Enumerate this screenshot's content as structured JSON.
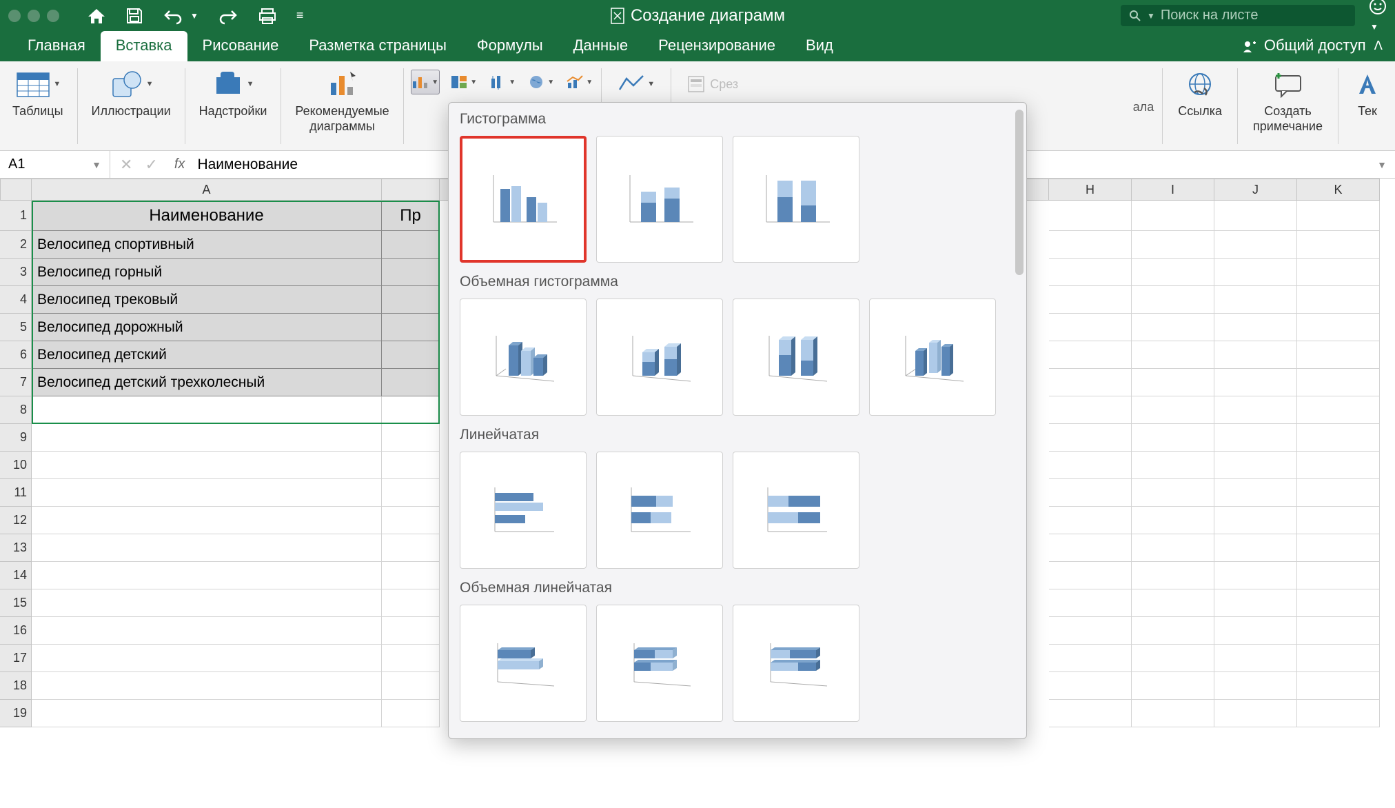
{
  "titlebar": {
    "doc_title": "Создание диаграмм",
    "search_placeholder": "Поиск на листе"
  },
  "tabs": {
    "items": [
      "Главная",
      "Вставка",
      "Рисование",
      "Разметка страницы",
      "Формулы",
      "Данные",
      "Рецензирование",
      "Вид"
    ],
    "active_index": 1,
    "share_label": "Общий доступ"
  },
  "ribbon": {
    "tables": "Таблицы",
    "illustrations": "Иллюстрации",
    "addins": "Надстройки",
    "recommended": "Рекомендуемые\nдиаграммы",
    "slicer": "Срез",
    "link": "Ссылка",
    "comment": "Создать\nпримечание",
    "text": "Тек",
    "timeline_trunc": "ала"
  },
  "formula_bar": {
    "name_box": "A1",
    "value": "Наименование"
  },
  "columns": [
    "A",
    "H",
    "I",
    "J",
    "K"
  ],
  "col_widths": {
    "A": 508,
    "B_partial": 84
  },
  "table": {
    "header": {
      "A": "Наименование",
      "B": "Пр"
    },
    "rows": [
      "Велосипед спортивный",
      "Велосипед горный",
      "Велосипед трековый",
      "Велосипед дорожный",
      "Велосипед детский",
      "Велосипед детский трехколесный"
    ]
  },
  "dropdown": {
    "sections": [
      {
        "title": "Гистограмма",
        "count": 3,
        "highlighted": 0
      },
      {
        "title": "Объемная гистограмма",
        "count": 4
      },
      {
        "title": "Линейчатая",
        "count": 3
      },
      {
        "title": "Объемная линейчатая",
        "count": 3
      }
    ]
  }
}
